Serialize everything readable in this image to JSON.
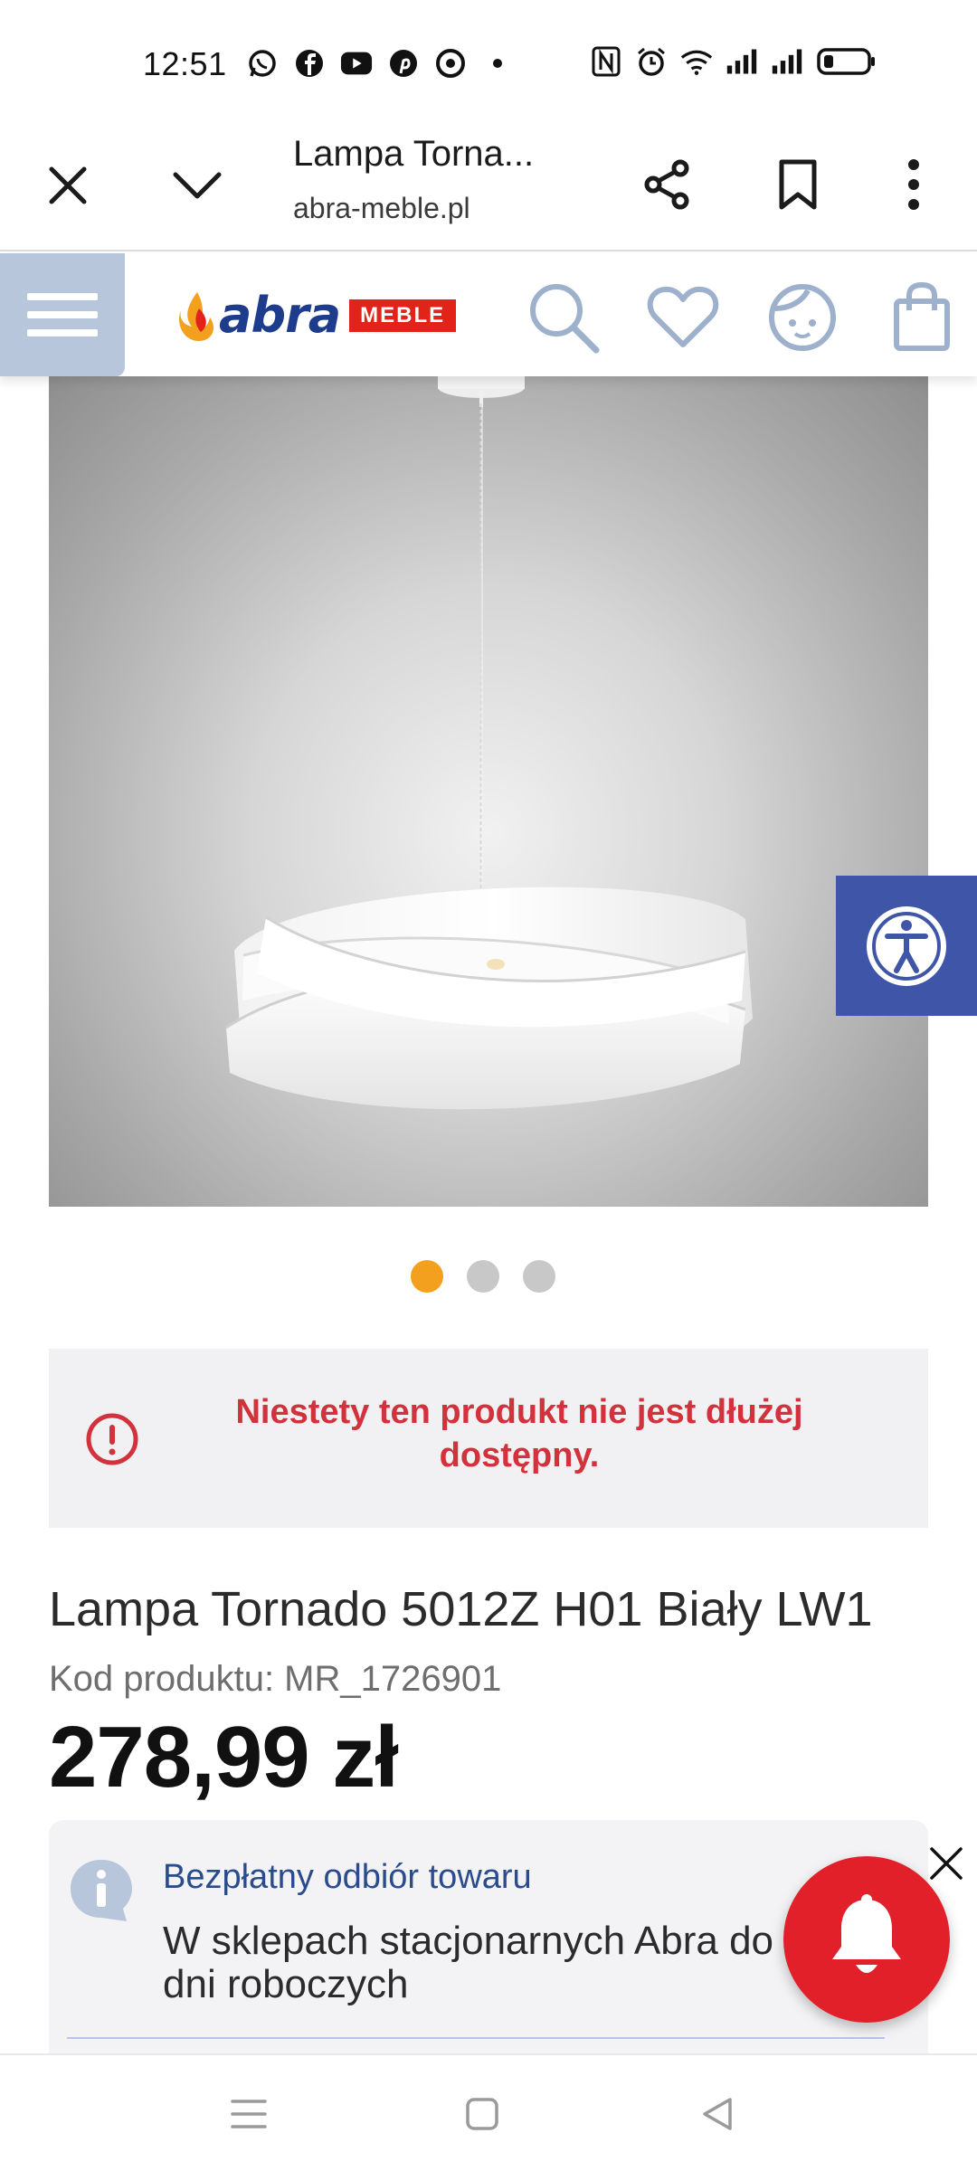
{
  "status_bar": {
    "time": "12:51",
    "left_icons": [
      "whatsapp-icon",
      "facebook-icon",
      "youtube-icon",
      "pinterest-icon",
      "chrome-icon",
      "dot-icon"
    ],
    "right_icons": [
      "nfc-icon",
      "alarm-icon",
      "wifi-icon",
      "signal-icon",
      "signal-icon",
      "battery-icon"
    ]
  },
  "browser": {
    "title": "Lampa Torna...",
    "url": "abra-meble.pl"
  },
  "site_header": {
    "logo_word": "abra",
    "logo_badge": "MEBLE",
    "icons": [
      "search-icon",
      "heart-icon",
      "account-icon",
      "cart-icon"
    ]
  },
  "gallery": {
    "active_index": 0,
    "count": 3
  },
  "alert": {
    "text": "Niestety ten produkt nie jest dłużej dostępny."
  },
  "product": {
    "title": "Lampa Tornado 5012Z H01 Biały LW1",
    "code": "Kod produktu: MR_1726901",
    "price": "278,99 zł"
  },
  "pickup": {
    "title": "Bezpłatny odbiór towaru",
    "text": "W sklepach stacjonarnych Abra do dni roboczych"
  },
  "colors": {
    "accent_orange": "#f2a01e",
    "alert_red": "#d2323c",
    "brand_blue": "#1d3c8c",
    "brand_red": "#e2231a",
    "a11y_blue": "#3f56a8"
  }
}
